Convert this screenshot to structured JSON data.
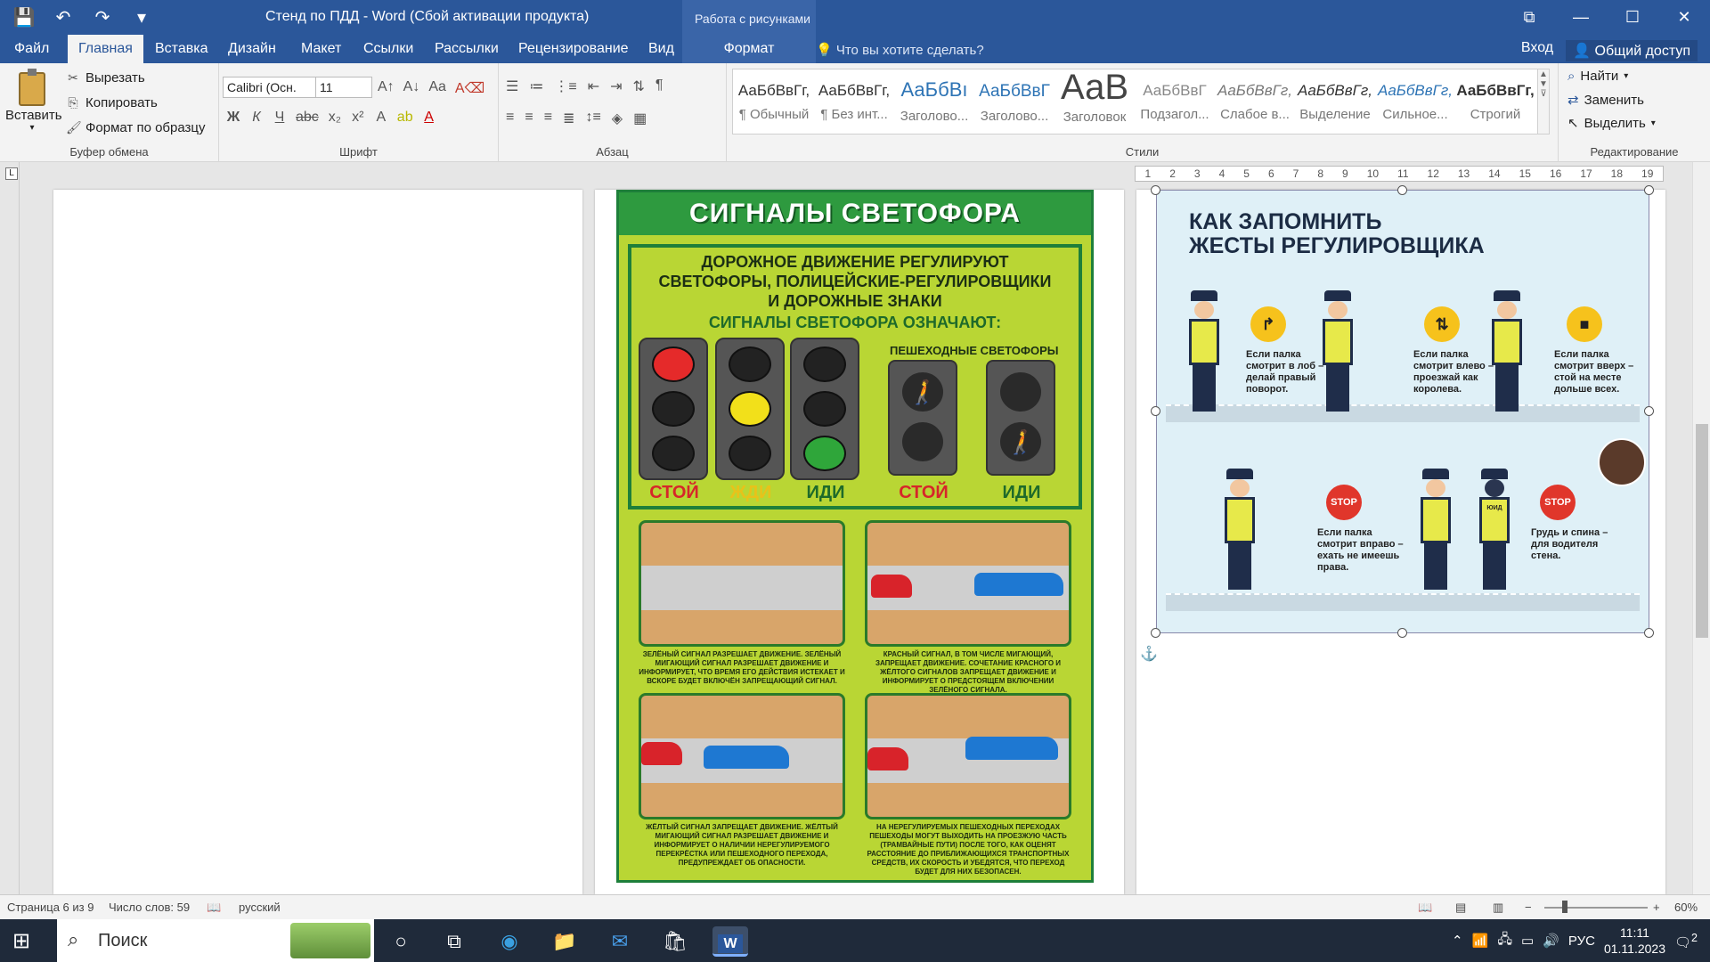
{
  "window": {
    "title": "Стенд по ПДД - Word (Сбой активации продукта)",
    "context_group": "Работа с рисунками",
    "controls": {
      "restore_ribbon": "⧉",
      "minimize": "—",
      "maximize": "☐",
      "close": "✕"
    }
  },
  "qat": {
    "save": "💾",
    "undo": "↶",
    "redo": "↷",
    "customize": "▾"
  },
  "tabs": [
    {
      "label": "Файл"
    },
    {
      "label": "Главная"
    },
    {
      "label": "Вставка"
    },
    {
      "label": "Дизайн"
    },
    {
      "label": "Макет"
    },
    {
      "label": "Ссылки"
    },
    {
      "label": "Рассылки"
    },
    {
      "label": "Рецензирование"
    },
    {
      "label": "Вид"
    },
    {
      "label": "Формат"
    }
  ],
  "tellme": "Что вы хотите сделать?",
  "signin": "Вход",
  "share": "Общий доступ",
  "ribbon": {
    "clipboard": {
      "paste": "Вставить",
      "cut": "Вырезать",
      "copy": "Копировать",
      "format_painter": "Формат по образцу",
      "label": "Буфер обмена"
    },
    "font": {
      "name": "Calibri (Осн.",
      "size": "11",
      "label": "Шрифт",
      "bold": "Ж",
      "italic": "К",
      "underline": "Ч"
    },
    "paragraph": {
      "label": "Абзац"
    },
    "styles": {
      "label": "Стили",
      "items": [
        {
          "sample": "АаБбВвГг,",
          "name": "¶ Обычный"
        },
        {
          "sample": "АаБбВвГг,",
          "name": "¶ Без инт..."
        },
        {
          "sample": "АаБбВı",
          "name": "Заголово..."
        },
        {
          "sample": "АаБбВвГ",
          "name": "Заголово..."
        },
        {
          "sample": "АаВ",
          "name": "Заголовок"
        },
        {
          "sample": "АаБбВвГ",
          "name": "Подзагол..."
        },
        {
          "sample": "АаБбВвГг,",
          "name": "Слабое в..."
        },
        {
          "sample": "АаБбВвГг,",
          "name": "Выделение"
        },
        {
          "sample": "АаБбВвГг,",
          "name": "Сильное..."
        },
        {
          "sample": "АаБбВвГг,",
          "name": "Строгий"
        }
      ]
    },
    "editing": {
      "label": "Редактирование",
      "find": "Найти",
      "replace": "Заменить",
      "select": "Выделить"
    }
  },
  "poster": {
    "title": "СИГНАЛЫ СВЕТОФОРА",
    "subtitle1": "ДОРОЖНОЕ ДВИЖЕНИЕ РЕГУЛИРУЮТ",
    "subtitle2": "СВЕТОФОРЫ, ПОЛИЦЕЙСКИЕ-РЕГУЛИРОВЩИКИ",
    "subtitle3": "И ДОРОЖНЫЕ ЗНАКИ",
    "signals_heading": "СИГНАЛЫ СВЕТОФОРА ОЗНАЧАЮТ:",
    "ped_heading": "ПЕШЕХОДНЫЕ СВЕТОФОРЫ",
    "words": {
      "stop": "СТОЙ",
      "wait": "ЖДИ",
      "go": "ИДИ",
      "ped_stop": "СТОЙ",
      "ped_go": "ИДИ"
    },
    "captions": {
      "green": "ЗЕЛЁНЫЙ СИГНАЛ РАЗРЕШАЕТ ДВИЖЕНИЕ. ЗЕЛЁНЫЙ МИГАЮЩИЙ СИГНАЛ РАЗРЕШАЕТ ДВИЖЕНИЕ И ИНФОРМИРУЕТ, ЧТО ВРЕМЯ ЕГО ДЕЙСТВИЯ ИСТЕКАЕТ И ВСКОРЕ БУДЕТ ВКЛЮЧЁН ЗАПРЕЩАЮЩИЙ СИГНАЛ.",
      "red": "КРАСНЫЙ СИГНАЛ, В ТОМ ЧИСЛЕ МИГАЮЩИЙ, ЗАПРЕЩАЕТ ДВИЖЕНИЕ. СОЧЕТАНИЕ КРАСНОГО И ЖЁЛТОГО СИГНАЛОВ ЗАПРЕЩАЕТ ДВИЖЕНИЕ И ИНФОРМИРУЕТ О ПРЕДСТОЯЩЕМ ВКЛЮЧЕНИИ ЗЕЛЁНОГО СИГНАЛА.",
      "yellow": "ЖЁЛТЫЙ СИГНАЛ ЗАПРЕЩАЕТ ДВИЖЕНИЕ. ЖЁЛТЫЙ МИГАЮЩИЙ СИГНАЛ РАЗРЕШАЕТ ДВИЖЕНИЕ И ИНФОРМИРУЕТ О НАЛИЧИИ НЕРЕГУЛИРУЕМОГО ПЕРЕКРЁСТКА ИЛИ ПЕШЕХОДНОГО ПЕРЕХОДА, ПРЕДУПРЕЖДАЕТ ОБ ОПАСНОСТИ.",
      "unregulated": "НА НЕРЕГУЛИРУЕМЫХ ПЕШЕХОДНЫХ ПЕРЕХОДАХ ПЕШЕХОДЫ МОГУТ ВЫХОДИТЬ НА ПРОЕЗЖУЮ ЧАСТЬ (ТРАМВАЙНЫЕ ПУТИ) ПОСЛЕ ТОГО, КАК ОЦЕНЯТ РАССТОЯНИЕ ДО ПРИБЛИЖАЮЩИХСЯ ТРАНСПОРТНЫХ СРЕДСТВ, ИХ СКОРОСТЬ И УБЕДЯТСЯ, ЧТО ПЕРЕХОД БУДЕТ ДЛЯ НИХ БЕЗОПАСЕН."
    }
  },
  "gestures": {
    "title1": "КАК ЗАПОМНИТЬ",
    "title2": "ЖЕСТЫ РЕГУЛИРОВЩИКА",
    "g1": "Если палка смотрит в лоб – делай правый поворот.",
    "g2": "Если палка смотрит влево – проезжай как королева.",
    "g3": "Если палка смотрит вверх – стой на месте дольше всех.",
    "g4": "Если палка смотрит вправо – ехать не имеешь права.",
    "g5": "Грудь и спина – для водителя стена.",
    "stop_sign": "STOP",
    "vest_text": "ЮИД"
  },
  "ruler_marks": [
    "1",
    "2",
    "3",
    "4",
    "5",
    "6",
    "7",
    "8",
    "9",
    "10",
    "11",
    "12",
    "13",
    "14",
    "15",
    "16",
    "17",
    "18",
    "19"
  ],
  "status": {
    "page": "Страница 6 из 9",
    "words": "Число слов: 59",
    "lang": "русский",
    "zoom": "60%"
  },
  "taskbar": {
    "search": "Поиск",
    "lang": "РУС",
    "time": "11:11",
    "date": "01.11.2023",
    "notif": "2"
  }
}
